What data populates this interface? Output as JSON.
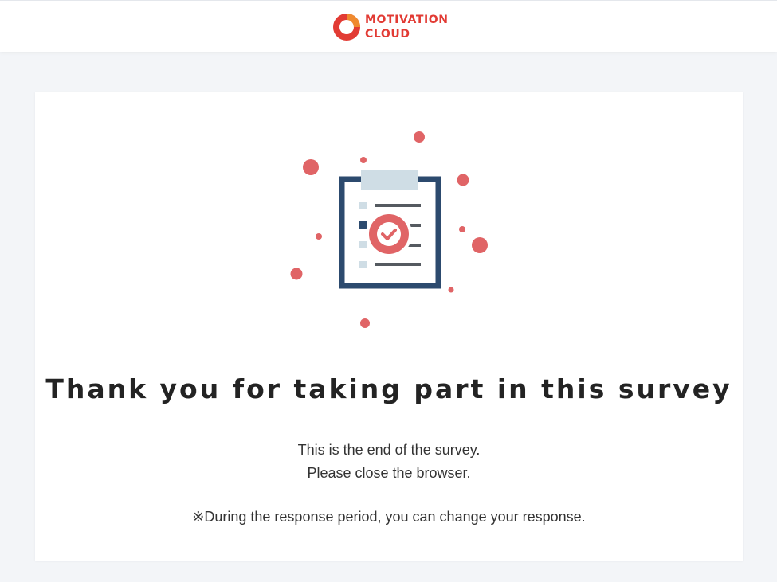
{
  "header": {
    "logo_line1": "MOTIVATION",
    "logo_line2": "CLOUD",
    "logo_icon": "motivation-cloud-ring-icon",
    "brand_color": "#e23b34"
  },
  "main": {
    "illustration_icon": "clipboard-check-icon",
    "title": "Thank you for taking part in this survey",
    "message_line1": "This is the end of the survey.",
    "message_line2": "Please close the browser.",
    "note": "※During the response period, you can change your response."
  },
  "colors": {
    "background": "#f3f5f8",
    "accent": "#e06466",
    "clipboard_navy": "#2c4a6e",
    "clip_gray": "#cfdde5"
  }
}
